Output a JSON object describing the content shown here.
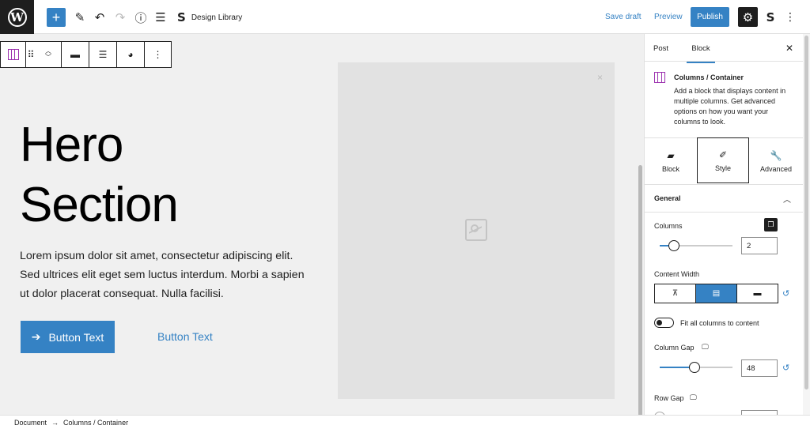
{
  "topbar": {
    "document_title": "Design Library",
    "save_draft": "Save draft",
    "preview": "Preview",
    "publish": "Publish",
    "icons": [
      "wordpress-logo",
      "plus",
      "pencil",
      "undo",
      "redo",
      "info",
      "list-view",
      "stackable-logo",
      "gear",
      "ellipsis-vertical"
    ]
  },
  "canvas": {
    "hero_title_line1": "Hero",
    "hero_title_line2": "Section",
    "hero_text": "Lorem ipsum dolor sit amet, consectetur adipiscing elit. Sed ultrices elit eget sem luctus interdum. Morbi a sapien ut dolor placerat consequat. Nulla facilisi.",
    "button_primary": "Button Text",
    "button_link": "Button Text",
    "image_close": "×"
  },
  "sidebar": {
    "tabs": [
      "Post",
      "Block"
    ],
    "active_tab": "Block",
    "block_name": "Columns / Container",
    "block_description": "Add a block that displays content in multiple columns. Get advanced options on how you want your columns to look.",
    "style_tabs": [
      "Block",
      "Style",
      "Advanced"
    ],
    "active_style_tab": "Style",
    "section_general": "General",
    "columns_label": "Columns",
    "columns_value": "2",
    "columns_slider_fraction": 0.2,
    "content_width_label": "Content Width",
    "fit_columns_label": "Fit all columns to content",
    "column_gap_label": "Column Gap",
    "column_gap_value": "48",
    "column_gap_slider_fraction": 0.48,
    "row_gap_label": "Row Gap"
  },
  "footer": {
    "breadcrumb_root": "Document",
    "breadcrumb_current": "Columns / Container"
  },
  "colors": {
    "accent": "#3582c4",
    "dark": "#1e1e1e",
    "canvas_bg": "#f0f0f0",
    "block_icon": "#9b2fae"
  }
}
